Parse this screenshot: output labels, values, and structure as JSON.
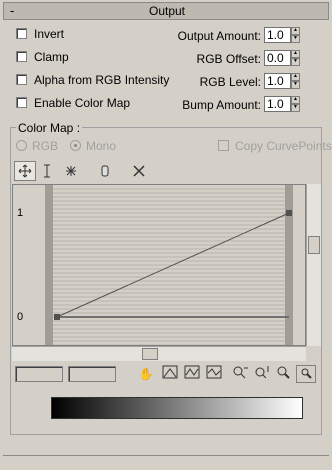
{
  "rollout": {
    "collapse_symbol": "-",
    "title": "Output"
  },
  "options": [
    {
      "label": "Invert",
      "checked": false
    },
    {
      "label": "Clamp",
      "checked": false
    },
    {
      "label": "Alpha from RGB Intensity",
      "checked": false
    },
    {
      "label": "Enable Color Map",
      "checked": false
    }
  ],
  "params": [
    {
      "label": "Output Amount:",
      "value": "1.0"
    },
    {
      "label": "RGB Offset:",
      "value": "0.0"
    },
    {
      "label": "RGB Level:",
      "value": "1.0"
    },
    {
      "label": "Bump Amount:",
      "value": "1.0"
    }
  ],
  "color_map": {
    "legend": "Color Map :",
    "radio_rgb": "RGB",
    "radio_mono": "Mono",
    "selected": "Mono",
    "copy_curvepoints": "Copy CurvePoints",
    "toolbar_icons": [
      "move-icon",
      "scale-point-icon",
      "insert-point-icon",
      "pan-hand-icon",
      "delete-point-icon"
    ],
    "curve": {
      "y_tick_top": "1",
      "y_tick_bottom": "0",
      "start": [
        0,
        0
      ],
      "end": [
        1,
        1
      ]
    },
    "bottom_icons": [
      "pan-icon",
      "zoom-extents-icon",
      "zoom-horizontal-extents-icon",
      "zoom-value-extents-icon",
      "zoom-horizontally-icon",
      "zoom-vertically-icon",
      "zoom-icon",
      "zoom-region-icon"
    ],
    "gradient": {
      "from": "#000000",
      "to": "#ffffff"
    }
  }
}
